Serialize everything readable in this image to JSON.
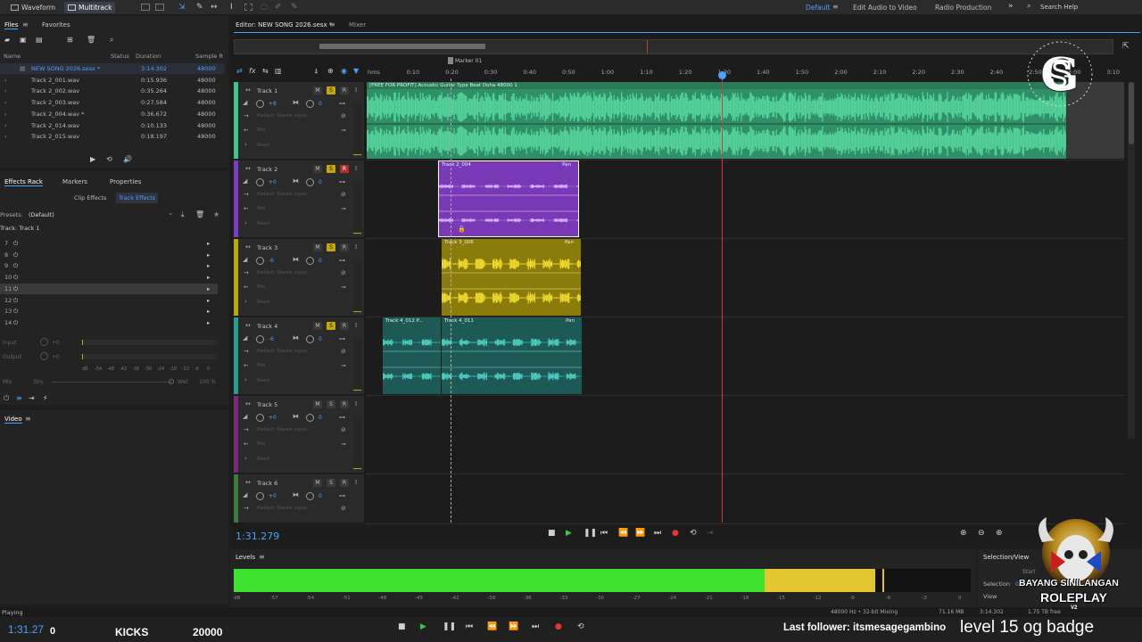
{
  "topbar": {
    "waveform_label": "Waveform",
    "multitrack_label": "Multitrack",
    "workspaces": [
      "Default",
      "Edit Audio to Video",
      "Radio Production"
    ],
    "search_placeholder": "Search Help",
    "expand_icon": "double-chevron-right-icon"
  },
  "files_panel": {
    "tab_files": "Files",
    "tab_favorites": "Favorites",
    "col_name": "Name",
    "col_status": "Status",
    "col_duration": "Duration",
    "col_rate": "Sample R",
    "files": [
      {
        "name": "NEW SONG 2026.sesx *",
        "duration": "3:14.302",
        "rate": "48000"
      },
      {
        "name": "Track 2_001.wav",
        "duration": "0:15.936",
        "rate": "48000"
      },
      {
        "name": "Track 2_002.wav",
        "duration": "0:35.264",
        "rate": "48000"
      },
      {
        "name": "Track 2_003.wav",
        "duration": "0:27.584",
        "rate": "48000"
      },
      {
        "name": "Track 2_004.wav *",
        "duration": "0:36.672",
        "rate": "48000"
      },
      {
        "name": "Track 2_014.wav",
        "duration": "0:10.133",
        "rate": "48000"
      },
      {
        "name": "Track 2_015.wav",
        "duration": "0:18.197",
        "rate": "48000"
      }
    ]
  },
  "effects_panel": {
    "tab_effects": "Effects Rack",
    "tab_markers": "Markers",
    "tab_properties": "Properties",
    "sub_clip": "Clip Effects",
    "sub_track": "Track Effects",
    "presets_label": "Presets:",
    "presets_value": "(Default)",
    "track_label": "Track: Track 1",
    "slots": [
      "7",
      "8",
      "9",
      "10",
      "11",
      "12",
      "13",
      "14"
    ],
    "input_label": "Input",
    "output_label": "Output",
    "input_val": "+0",
    "output_val": "+0",
    "mix_label": "Mix",
    "dry_label": "Dry",
    "wet_label": "Wet",
    "wet_val": "100 %",
    "meter_scale": [
      "dB",
      "-54",
      "-48",
      "-42",
      "-36",
      "-30",
      "-24",
      "-18",
      "-12",
      "-6",
      "0"
    ]
  },
  "video_panel": {
    "label": "Video"
  },
  "editor": {
    "tab_label": "Editor: NEW SONG 2026.sesx *",
    "mixer_label": "Mixer",
    "marker_label": "Marker 01",
    "ruler": [
      "hms",
      "0:10",
      "0:20",
      "0:30",
      "0:40",
      "0:50",
      "1:00",
      "1:10",
      "1:20",
      "1:30",
      "1:40",
      "1:50",
      "2:00",
      "2:10",
      "2:20",
      "2:30",
      "2:40",
      "2:50",
      "3:00",
      "3:10"
    ],
    "tracks": [
      {
        "name": "Track 1",
        "vol": "+8",
        "pan": "0",
        "input": "Default Stereo Input",
        "mix": "Mix",
        "read": "Read",
        "solo": true,
        "rec": false,
        "color": "#3fc58a"
      },
      {
        "name": "Track 2",
        "vol": "+0",
        "pan": "0",
        "input": "Default Stereo Input",
        "mix": "Mix",
        "read": "Read",
        "solo": true,
        "rec": true,
        "color": "#7a3cc0"
      },
      {
        "name": "Track 3",
        "vol": "-6",
        "pan": "0",
        "input": "Default Stereo Input",
        "mix": "Mix",
        "read": "Read",
        "solo": true,
        "rec": false,
        "color": "#b8a800"
      },
      {
        "name": "Track 4",
        "vol": "-6",
        "pan": "0",
        "input": "Default Stereo Input",
        "mix": "Mix",
        "read": "Read",
        "solo": true,
        "rec": false,
        "color": "#2a9c90"
      },
      {
        "name": "Track 5",
        "vol": "+0",
        "pan": "0",
        "input": "Default Stereo Input",
        "mix": "Mix",
        "read": "Read",
        "solo": false,
        "rec": false,
        "color": "#7a2a7a"
      },
      {
        "name": "Track 6",
        "vol": "+0",
        "pan": "0",
        "input": "Default Stereo Input",
        "mix": "Mix",
        "read": "Read",
        "solo": false,
        "rec": false,
        "color": "#3a7a3a"
      }
    ],
    "clips": {
      "t1": "[FREE FOR PROFIT] Acoustic Guitar Type Beat Doha 48000 1",
      "t2": "Track 2_004",
      "t3": "Track 3_006",
      "t4a": "Track 4_012 P...",
      "t4b": "Track 4_011",
      "pan": "Pan"
    },
    "time": "1:31.279"
  },
  "levels": {
    "label": "Levels",
    "scale": [
      "dB",
      "-57",
      "-54",
      "-51",
      "-48",
      "-45",
      "-42",
      "-39",
      "-36",
      "-33",
      "-30",
      "-27",
      "-24",
      "-21",
      "-18",
      "-15",
      "-12",
      "-9",
      "-6",
      "-3",
      "0"
    ],
    "level_left_fraction": 0.87,
    "level_yellow_start": 0.72
  },
  "selection_view": {
    "label": "Selection/View",
    "start": "Start",
    "selection": "Selection",
    "view": "View",
    "end_value": "0:00"
  },
  "statusbar": {
    "status": "Playing",
    "format": "48000 Hz • 32-bit Mixing",
    "mem": "71.16 MB",
    "duration": "3:14.302",
    "free": "1.75 TB free"
  },
  "overlay": {
    "time": "1:31.27",
    "zero": "0",
    "kicks": "KICKS",
    "score": "20000",
    "follower": "Last follower: itsmesagegambino",
    "level": "level 15 og badge",
    "logo_bottom": "BAYANG SINILANGAN",
    "logo_bottom2": "ROLEPLAY",
    "logo_bottom3": "V2"
  }
}
